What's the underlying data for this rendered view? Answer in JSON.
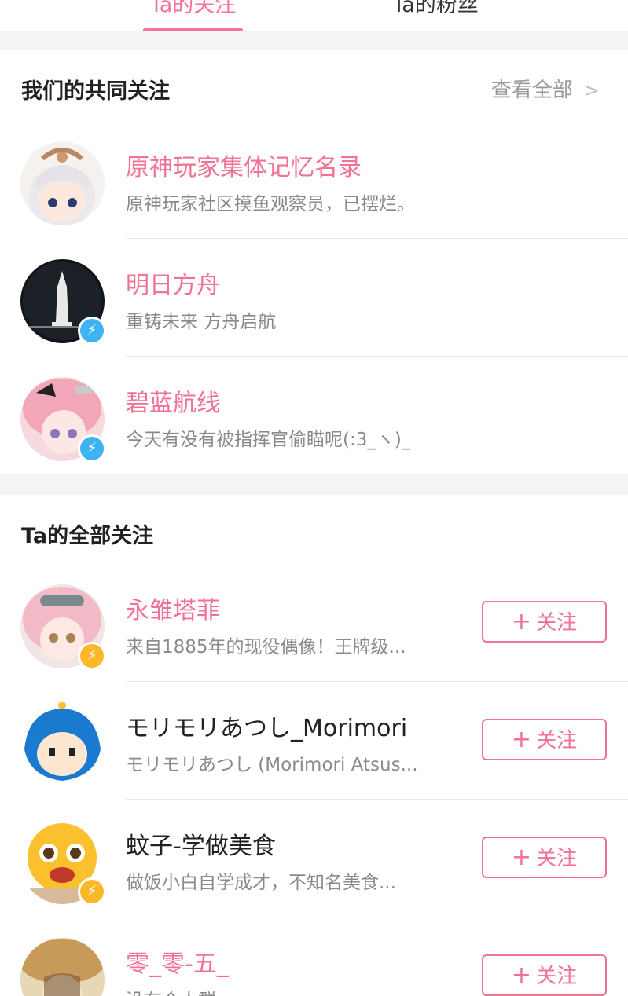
{
  "tabs": [
    {
      "label": "Ta的关注",
      "active": true
    },
    {
      "label": "Ta的粉丝",
      "active": false
    }
  ],
  "mutual": {
    "title": "我们的共同关注",
    "view_all": "查看全部",
    "items": [
      {
        "name": "原神玩家集体记忆名录",
        "desc": "原神玩家社区摸鱼观察员，已摆烂。",
        "name_color": "pink",
        "badge": ""
      },
      {
        "name": "明日方舟",
        "desc": "重铸未来 方舟启航",
        "name_color": "pink",
        "badge": "blue"
      },
      {
        "name": "碧蓝航线",
        "desc": "今天有没有被指挥官偷瞄呢(:3_ヽ)_",
        "name_color": "pink",
        "badge": "blue"
      }
    ]
  },
  "all": {
    "title": "Ta的全部关注",
    "follow_label": "关注",
    "items": [
      {
        "name": "永雏塔菲",
        "desc": "来自1885年的现役偶像！王牌级...",
        "name_color": "pink",
        "badge": "gold"
      },
      {
        "name": "モリモリあつし_Morimori",
        "desc": "モリモリあつし (Morimori Atsus...",
        "name_color": "dark",
        "badge": ""
      },
      {
        "name": "蚊子-学做美食",
        "desc": "做饭小白自学成才，不知名美食...",
        "name_color": "dark",
        "badge": "gold"
      },
      {
        "name": "零_零-五_",
        "desc": "没有个人群",
        "name_color": "pink",
        "badge": ""
      }
    ]
  },
  "colors": {
    "accent": "#fb7299",
    "name_pink": "#f27294",
    "badge_blue": "#3fb2f4",
    "badge_gold": "#fdb82a"
  },
  "icons": {
    "chevron": "chevron-right-icon",
    "badge": "lightning-icon",
    "plus": "plus-icon"
  }
}
